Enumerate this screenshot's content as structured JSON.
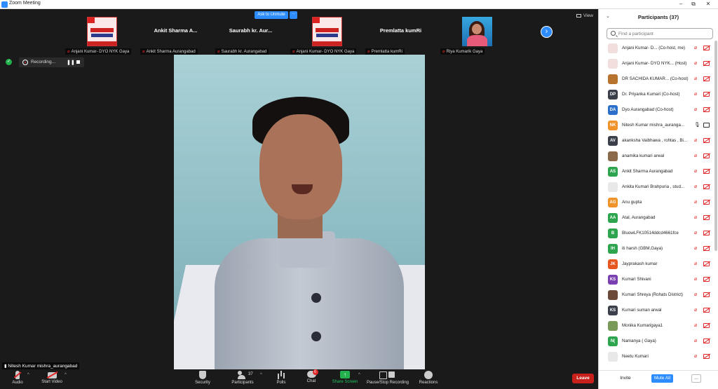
{
  "window": {
    "title": "Zoom Meeting",
    "minimize": "–",
    "maximize": "⧉",
    "close": "✕"
  },
  "top_bar": {
    "ask_to_unmute": "Ask to Unmute",
    "more": "···",
    "view": "View",
    "next": "›"
  },
  "gallery": [
    {
      "name": "",
      "label": "Anjani Kumar- DYO NYK Gaya",
      "kind": "poster"
    },
    {
      "name": "Ankit Sharma A...",
      "label": "Ankit Sharma Aurangabad",
      "kind": "name"
    },
    {
      "name": "Saurabh kr. Aur...",
      "label": "Saurabh kr. Aurangabad",
      "kind": "name"
    },
    {
      "name": "",
      "label": "Anjani Kumar- DYO NYK Gaya",
      "kind": "poster"
    },
    {
      "name": "Premlatta kumRi",
      "label": "Premlatta kumRi",
      "kind": "name"
    },
    {
      "name": "",
      "label": "Riya Kumarik Gaya",
      "kind": "photo"
    }
  ],
  "recording": {
    "label": "Recording...",
    "pause": "❚❚"
  },
  "speaker": {
    "name": "Nitesh Kumar mishra_aurangabad"
  },
  "toolbar": {
    "audio": "Audio",
    "video": "Start Video",
    "security": "Security",
    "participants": "Participants",
    "participants_count": "37",
    "polls": "Polls",
    "chat": "Chat",
    "chat_badge": "6",
    "share": "Share Screen",
    "recording": "Pause/Stop Recording",
    "reactions": "Reactions",
    "leave": "Leave",
    "share_arrow": "↑",
    "caret": "^"
  },
  "panel": {
    "title": "Participants (37)",
    "collapse": "⌄",
    "search_placeholder": "Find a participant",
    "invite": "Invite",
    "mute_all": "Mute All",
    "more": "..."
  },
  "participants": [
    {
      "initials": "",
      "name": "Anjani Kumar- D... (Co-host, me)",
      "color": "#f3dede",
      "mic": "off",
      "cam": "off"
    },
    {
      "initials": "",
      "name": "Anjani Kumar- DYO NYK... (Host)",
      "color": "#f3dede",
      "mic": "off",
      "cam": "off"
    },
    {
      "initials": "",
      "name": "DR SACHIDA KUMAR... (Co-host)",
      "color": "#b8732e",
      "mic": "off",
      "cam": "off"
    },
    {
      "initials": "DP",
      "name": "Dr. Priyanka Kumari (Co-host)",
      "color": "#3a3f4a",
      "mic": "off",
      "cam": "off"
    },
    {
      "initials": "DA",
      "name": "Dyo Aurangabad (Co-host)",
      "color": "#2a6fc9",
      "mic": "off",
      "cam": "off"
    },
    {
      "initials": "NK",
      "name": "Nitesh Kumar mishra_auranga...",
      "color": "#f0932b",
      "mic": "on",
      "cam": "on"
    },
    {
      "initials": "AV",
      "name": "akanksha Vaibhawa , rohtas , Bi...",
      "color": "#3a3f4a",
      "mic": "off",
      "cam": "off"
    },
    {
      "initials": "",
      "name": "anamika kumari arwal",
      "color": "#8a6a4a",
      "mic": "off",
      "cam": "off"
    },
    {
      "initials": "AS",
      "name": "Ankit Sharma Aurangabad",
      "color": "#2da44e",
      "mic": "off",
      "cam": "off"
    },
    {
      "initials": "",
      "name": "Ankita Kumari Brahpuria , stud...",
      "color": "#e8e8e8",
      "mic": "off",
      "cam": "off"
    },
    {
      "initials": "AG",
      "name": "Anu gupta",
      "color": "#f0932b",
      "mic": "off",
      "cam": "off"
    },
    {
      "initials": "AA",
      "name": "Atal, Aurangabad",
      "color": "#2da44e",
      "mic": "off",
      "cam": "off"
    },
    {
      "initials": "B",
      "name": "BluowLFK10514ddcd4661fce",
      "color": "#2da44e",
      "mic": "off",
      "cam": "off"
    },
    {
      "initials": "IH",
      "name": "iti harsh (GBM,Gaya)",
      "color": "#2da44e",
      "mic": "off",
      "cam": "off"
    },
    {
      "initials": "JK",
      "name": "Jayprakash kumar",
      "color": "#e8561f",
      "mic": "off",
      "cam": "off"
    },
    {
      "initials": "KS",
      "name": "Kumari Shivani",
      "color": "#7a3fb0",
      "mic": "off",
      "cam": "off"
    },
    {
      "initials": "",
      "name": "Kumari Shreya (Rohats District)",
      "color": "#6b4a3a",
      "mic": "off",
      "cam": "off"
    },
    {
      "initials": "KS",
      "name": "Kumari suman  arwal",
      "color": "#3a3f4a",
      "mic": "off",
      "cam": "off"
    },
    {
      "initials": "",
      "name": "Monika Kumarigaya1",
      "color": "#7a9a5a",
      "mic": "off",
      "cam": "off"
    },
    {
      "initials": "N(",
      "name": "Namanya ( Gaya)",
      "color": "#2da44e",
      "mic": "off",
      "cam": "off"
    },
    {
      "initials": "",
      "name": "Neetu Kumari",
      "color": "#e8e8e8",
      "mic": "off",
      "cam": "off"
    }
  ]
}
